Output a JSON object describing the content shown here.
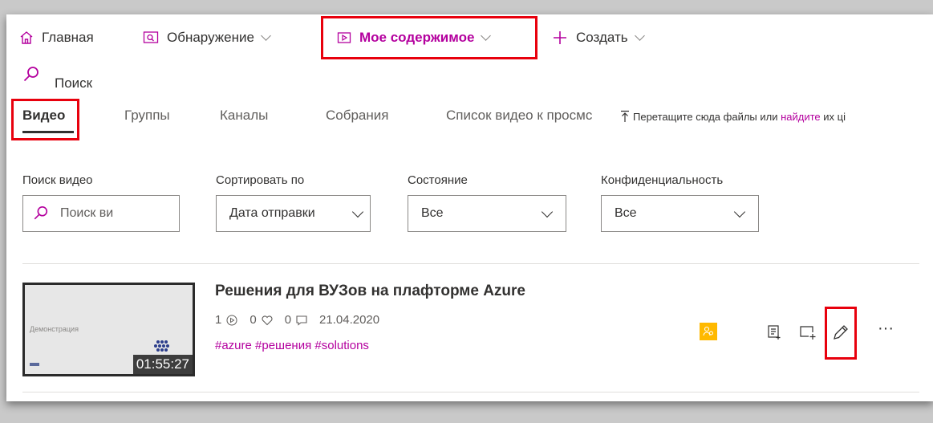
{
  "nav": {
    "home_label": "Главная",
    "discover_label": "Обнаружение",
    "my_content_label": "Мое содержимое",
    "create_label": "Создать"
  },
  "search": {
    "placeholder": "Поиск"
  },
  "tabs": [
    {
      "label": "Видео"
    },
    {
      "label": "Группы"
    },
    {
      "label": "Каналы"
    },
    {
      "label": "Собрания"
    },
    {
      "label": "Список видео к просмс"
    }
  ],
  "upload": {
    "text_before": "Перетащите сюда файлы или ",
    "link": "найдите",
    "text_after": " их ці"
  },
  "filters": {
    "search_videos_label": "Поиск видео",
    "search_videos_placeholder": "Поиск ви",
    "sort_label": "Сортировать по",
    "sort_value": "Дата отправки",
    "status_label": "Состояние",
    "status_value": "Все",
    "privacy_label": "Конфиденциальность",
    "privacy_value": "Все"
  },
  "video": {
    "title": "Решения для ВУЗов на плафторме Azure",
    "views": "1",
    "likes": "0",
    "comments": "0",
    "date": "21.04.2020",
    "tags": "#azure #решения #solutions",
    "duration": "01:55:27",
    "thumbnail_text": "Демонстрация",
    "more_label": "···"
  },
  "colors": {
    "accent": "#b4009e",
    "highlight_box": "#e8000d",
    "privacy_badge": "#ffb900"
  }
}
